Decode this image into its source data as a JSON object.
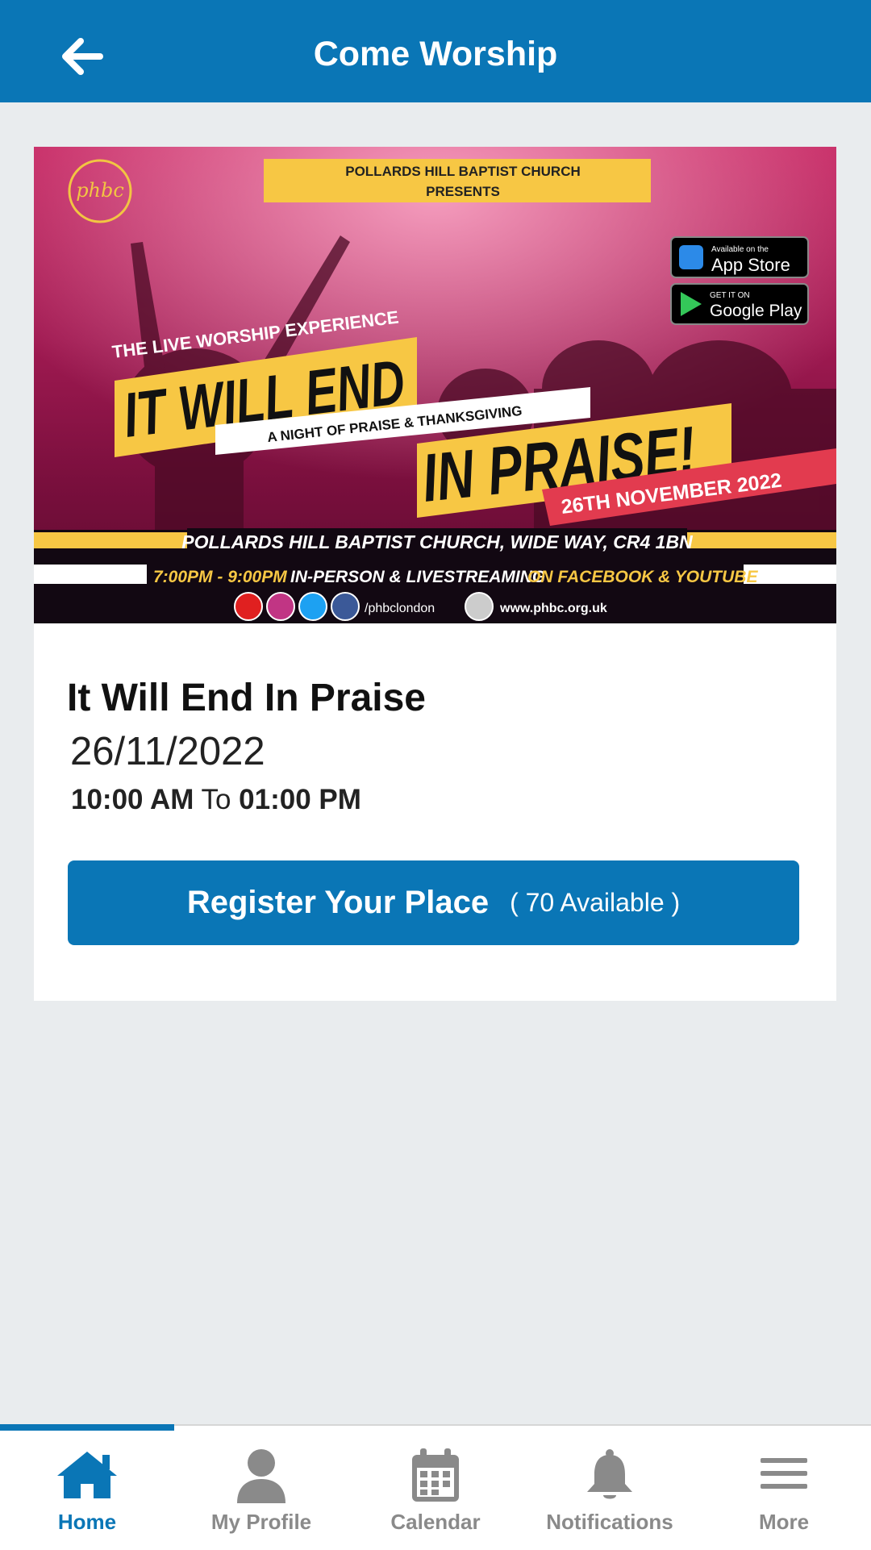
{
  "header": {
    "title": "Come Worship",
    "back_icon": "arrow-left-icon",
    "background": "#0a76b6"
  },
  "banner": {
    "logo_text": "phbc",
    "top_line_1": "POLLARDS HILL BAPTIST CHURCH",
    "top_line_2": "PRESENTS",
    "appstore_small": "Available on the",
    "appstore_big": "App Store",
    "googleplay_small": "GET IT ON",
    "googleplay_big": "Google Play",
    "experience": "THE LIVE WORSHIP EXPERIENCE",
    "headline_1": "IT WILL END",
    "subhead": "A NIGHT OF PRAISE & THANKSGIVING",
    "headline_2": "IN PRAISE!",
    "date_badge": "26TH NOVEMBER 2022",
    "venue": "POLLARDS HILL BAPTIST CHURCH, WIDE WAY, CR4 1BN",
    "times": "7:00PM - 9:00PM",
    "in_person": "IN-PERSON & LIVESTREAMING",
    "platforms": "ON FACEBOOK & YOUTUBE",
    "handle": "/phbclondon",
    "website": "www.phbc.org.uk",
    "accent": "#f7c744",
    "date_badge_color": "#e23b4f"
  },
  "event": {
    "title": "It Will End In Praise",
    "date": "26/11/2022",
    "start": "10:00 AM",
    "to": "To",
    "end": "01:00 PM"
  },
  "register": {
    "label": "Register Your Place",
    "open_paren": "(",
    "available": "70 Available",
    "close_paren": ")"
  },
  "tabbar": {
    "active_color": "#0a76b6",
    "inactive_color": "#8a8a8a",
    "tabs": [
      {
        "label": "Home",
        "icon": "home-icon",
        "active": true
      },
      {
        "label": "My Profile",
        "icon": "person-icon",
        "active": false
      },
      {
        "label": "Calendar",
        "icon": "calendar-icon",
        "active": false
      },
      {
        "label": "Notifications",
        "icon": "bell-icon",
        "active": false
      },
      {
        "label": "More",
        "icon": "menu-icon",
        "active": false
      }
    ]
  }
}
